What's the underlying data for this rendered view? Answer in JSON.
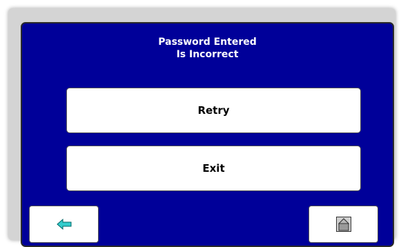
{
  "dialog": {
    "title_line1": "Password Entered",
    "title_line2": "Is Incorrect"
  },
  "buttons": {
    "retry_label": "Retry",
    "exit_label": "Exit"
  },
  "nav": {
    "back_icon": "arrow-left-icon",
    "home_icon": "home-icon"
  },
  "colors": {
    "panel_background": "#000099",
    "button_background": "#ffffff",
    "back_arrow": "#33cccc"
  }
}
